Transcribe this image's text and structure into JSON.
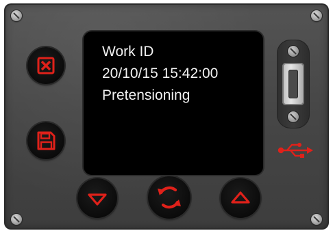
{
  "display": {
    "line1": "Work ID",
    "line2": "20/10/15 15:42:00",
    "line3": "Pretensioning"
  },
  "buttons": {
    "cancel": {
      "icon": "close-icon"
    },
    "save": {
      "icon": "floppy-disk-icon"
    },
    "down": {
      "icon": "triangle-down-icon"
    },
    "refresh": {
      "icon": "refresh-icon"
    },
    "up": {
      "icon": "triangle-up-icon"
    }
  },
  "port": {
    "icon": "usb-icon"
  },
  "colors": {
    "accent": "#e0211a",
    "panel": "#4a4a4a",
    "screen": "#000000",
    "text": "#f2f2f2"
  }
}
